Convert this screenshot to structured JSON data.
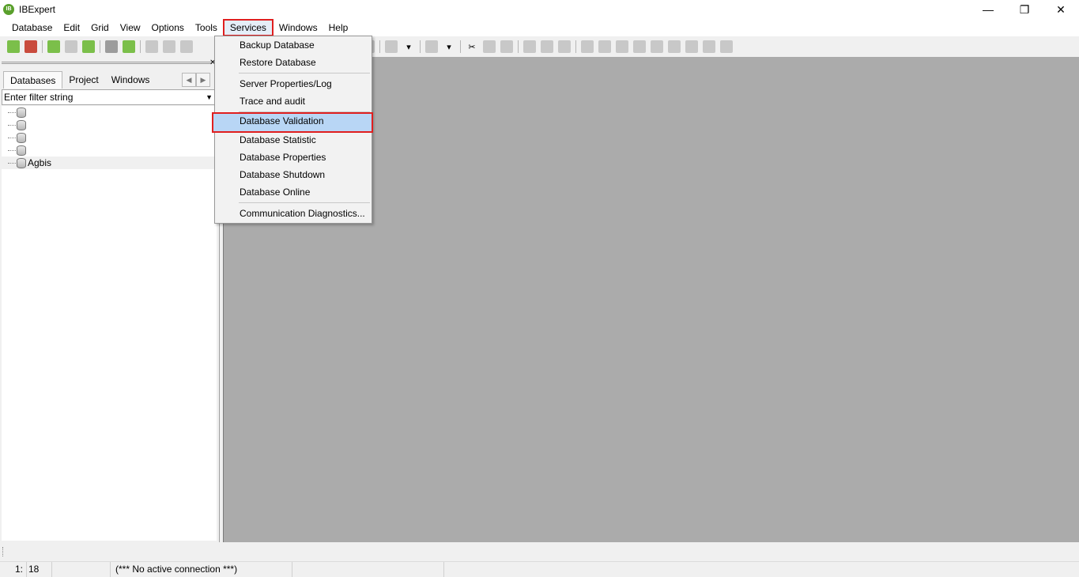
{
  "window": {
    "title": "IBExpert",
    "logo_text": "IB"
  },
  "menubar": {
    "items": [
      "Database",
      "Edit",
      "Grid",
      "View",
      "Options",
      "Tools",
      "Services",
      "Windows",
      "Help"
    ],
    "active": "Services"
  },
  "panel": {
    "tabs": [
      "Databases",
      "Project",
      "Windows"
    ],
    "filter_placeholder": "Enter filter string",
    "tree": [
      "",
      "",
      "",
      "",
      "Agbis"
    ]
  },
  "services_menu": {
    "items": [
      "Backup Database",
      "Restore Database",
      "Server Properties/Log",
      "Trace and audit",
      "Database Validation",
      "Database Statistic",
      "Database Properties",
      "Database Shutdown",
      "Database Online",
      "Communication Diagnostics..."
    ],
    "highlighted": "Database Validation"
  },
  "statusbar": {
    "line": "1:",
    "col": "18",
    "message": "(*** No active connection ***)"
  },
  "colors": {
    "highlight_border": "#e01f1f",
    "selection": "#b8d6f5",
    "workspace": "#ababab"
  }
}
